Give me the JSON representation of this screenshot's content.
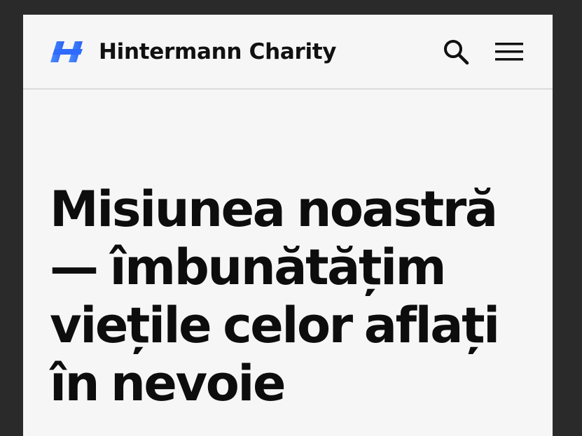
{
  "header": {
    "brand_name": "Hintermann Charity",
    "logo_icon": "hintermann-h-logo",
    "search_icon": "search-icon",
    "menu_icon": "hamburger-menu-icon"
  },
  "hero": {
    "title": "Misiunea noastră — îmbunătățim viețile celor aflați în nevoie"
  },
  "colors": {
    "outer_background": "#2a2a2a",
    "page_background": "#f6f6f6",
    "logo_blue": "#2f6bff",
    "logo_blue_light": "#4a8cff",
    "text": "#0d0d0d",
    "divider": "#dcdcdc"
  }
}
